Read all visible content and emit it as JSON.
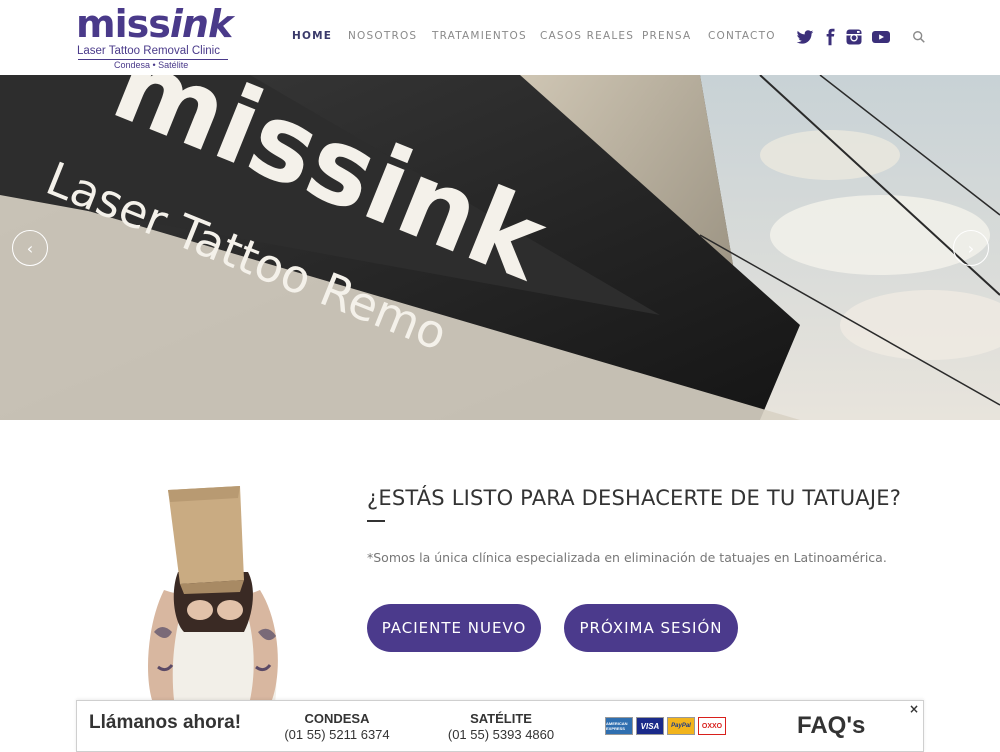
{
  "logo": {
    "main_a": "miss",
    "main_b": "ink",
    "subtitle": "Laser Tattoo Removal Clinic",
    "locations": "Condesa • Satélite"
  },
  "nav": {
    "items": [
      {
        "label": "HOME",
        "active": true
      },
      {
        "label": "NOSOTROS",
        "active": false
      },
      {
        "label": "TRATAMIENTOS",
        "active": false
      },
      {
        "label": "CASOS REALES",
        "active": false
      },
      {
        "label": "PRENSA",
        "active": false
      },
      {
        "label": "CONTACTO",
        "active": false
      }
    ],
    "social": [
      "twitter-icon",
      "facebook-icon",
      "instagram-icon",
      "youtube-icon"
    ],
    "search": "search-icon",
    "colors": {
      "social": "#3b2f7a",
      "active": "#3a3a6a",
      "inactive": "#8a8a8a"
    }
  },
  "hero": {
    "sign_text_a": "missink",
    "sign_text_b": "Laser Tattoo Remo",
    "prev_arrow": "‹",
    "next_arrow": "›"
  },
  "main": {
    "heading": "¿ESTÁS LISTO PARA DESHACERTE DE TU TATUAJE?",
    "subtext": "*Somos la única clínica especializada en eliminación de tatuajes en Latinoamérica.",
    "buttons": [
      {
        "label": "PACIENTE NUEVO"
      },
      {
        "label": "PRÓXIMA SESIÓN"
      }
    ],
    "accent": "#4b3a8c"
  },
  "callbar": {
    "title": "Llámanos ahora!",
    "branches": [
      {
        "name": "CONDESA",
        "phone": "(01 55) 5211 6374"
      },
      {
        "name": "SATÉLITE",
        "phone": "(01 55) 5393 4860"
      }
    ],
    "cards": [
      "AMERICAN EXPRESS",
      "VISA",
      "PayPal",
      "OXXO"
    ],
    "faq": "FAQ's",
    "close": "×"
  }
}
